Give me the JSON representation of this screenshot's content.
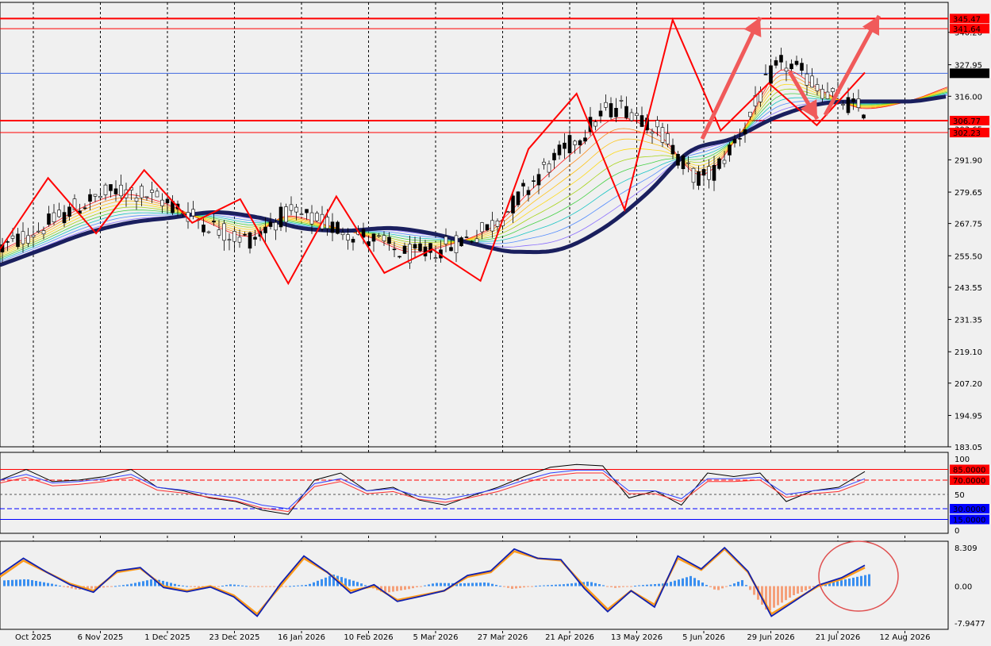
{
  "chart_data": [
    {
      "type": "candlestick",
      "panel": "price",
      "y_ticks": [
        "340.26",
        "327.95",
        "316.00",
        "303.65",
        "291.90",
        "279.65",
        "267.75",
        "255.50",
        "243.55",
        "231.35",
        "219.10",
        "207.20",
        "194.95",
        "183.05"
      ],
      "ylim": [
        183.05,
        349.5
      ],
      "current_price": "324.72",
      "levels": [
        {
          "label": "345.47",
          "value": 345.47,
          "color": "#ff0000"
        },
        {
          "label": "341.64",
          "value": 341.64,
          "color": "#ff0000"
        },
        {
          "label": "306.77",
          "value": 306.77,
          "color": "#ff0000"
        },
        {
          "label": "302.23",
          "value": 302.23,
          "color": "#ff0000"
        }
      ],
      "x_ticks": [
        "Oct 2025",
        "6 Nov 2025",
        "1 Dec 2025",
        "23 Dec 2025",
        "16 Jan 2026",
        "10 Feb 2026",
        "5 Mar 2026",
        "27 Mar 2026",
        "21 Apr 2026",
        "13 May 2026",
        "5 Jun 2026",
        "29 Jun 2026",
        "21 Jul 2026",
        "12 Aug 2026"
      ],
      "trend_line": [
        258,
        285,
        264,
        288,
        268,
        277,
        245,
        278,
        249,
        258,
        246,
        296,
        317,
        273,
        345,
        303,
        321,
        305,
        325
      ],
      "slow_ma": [
        252,
        258,
        264,
        268,
        270,
        272,
        270,
        266,
        265,
        266,
        264,
        260,
        257,
        258,
        266,
        279,
        295,
        300,
        308,
        313,
        314,
        314,
        316
      ],
      "gmma": [
        258,
        266,
        275,
        280,
        276,
        268,
        262,
        271,
        267,
        262,
        256,
        260,
        268,
        285,
        300,
        312,
        303,
        285,
        303,
        328,
        318,
        311,
        314,
        320
      ]
    },
    {
      "type": "line",
      "panel": "oscillator",
      "y_ticks": [
        "100",
        "85.0000",
        "70.0000",
        "50",
        "30.0000",
        "15.0000",
        "0"
      ],
      "levels": [
        85,
        70,
        50,
        30,
        15
      ],
      "series": [
        {
          "values": [
            70,
            85,
            68,
            70,
            75,
            85,
            60,
            55,
            45,
            40,
            28,
            22,
            70,
            80,
            55,
            60,
            42,
            35,
            48,
            60,
            75,
            88,
            92,
            90,
            45,
            55,
            35,
            80,
            75,
            80,
            40,
            55,
            60,
            82
          ]
        },
        {
          "values": [
            70,
            78,
            66,
            68,
            72,
            78,
            60,
            56,
            50,
            45,
            35,
            30,
            65,
            72,
            55,
            58,
            47,
            43,
            50,
            58,
            70,
            80,
            84,
            84,
            55,
            55,
            44,
            72,
            72,
            74,
            50,
            55,
            58,
            72
          ]
        }
      ]
    },
    {
      "type": "bar",
      "panel": "macd",
      "y_ticks": [
        "8.309",
        "0.00",
        "-7.9477"
      ],
      "ylim": [
        -7.9477,
        8.309
      ],
      "histogram": [
        1.2,
        1.5,
        0.5,
        -0.8,
        -0.3,
        0.4,
        1.6,
        0.2,
        -0.5,
        0.4,
        -0.2,
        -0.1,
        0.3,
        2.5,
        0.8,
        -1.5,
        -0.6,
        0.7,
        0.6,
        0.8,
        -0.6,
        0.1,
        0.4,
        1.0,
        -0.4,
        0.2,
        0.6,
        2.2,
        -1.0,
        1.3,
        -5.5,
        -2.0,
        0.2,
        1.4,
        2.6
      ],
      "signal": [
        2.0,
        5.5,
        3.0,
        0.5,
        -1.0,
        3.0,
        3.8,
        0.0,
        -1.0,
        0.0,
        -2.0,
        -6.0,
        0.0,
        6.0,
        3.0,
        -1.0,
        0.0,
        -3.0,
        -2.0,
        -1.0,
        2.0,
        3.0,
        7.5,
        6.0,
        5.5,
        0.0,
        -5.0,
        -1.0,
        -4.0,
        6.0,
        3.5,
        8.0,
        3.0,
        -6.0,
        -3.0,
        0.0,
        1.5,
        4.0
      ],
      "macd": [
        2.5,
        6.0,
        3.0,
        0.3,
        -1.3,
        3.3,
        4.0,
        -0.3,
        -1.2,
        -0.2,
        -2.3,
        -6.5,
        0.5,
        6.5,
        3.0,
        -1.5,
        0.3,
        -3.3,
        -2.2,
        -1.0,
        2.3,
        3.3,
        8.0,
        6.0,
        5.7,
        -0.5,
        -5.5,
        -1.0,
        -4.5,
        6.5,
        3.7,
        8.3,
        3.2,
        -6.5,
        -3.2,
        0.2,
        1.8,
        4.5
      ]
    }
  ]
}
